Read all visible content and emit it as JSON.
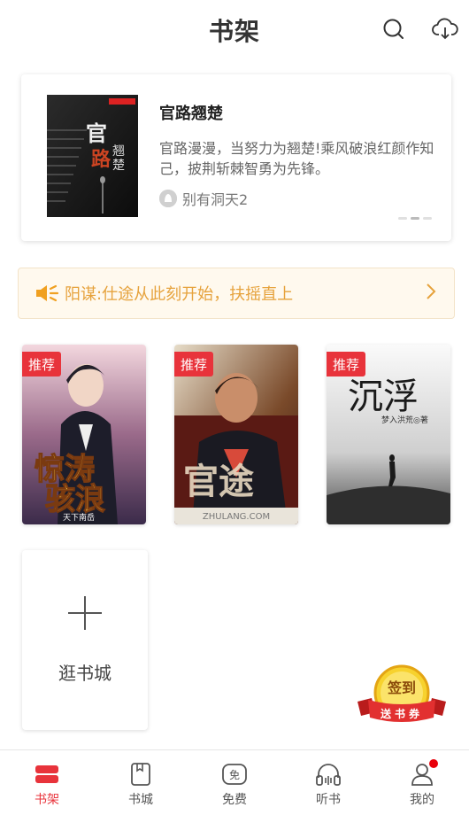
{
  "header": {
    "title": "书架",
    "search_icon": "search-icon",
    "cloud_icon": "cloud-download-icon"
  },
  "featured": {
    "cover_title": "官路翘楚",
    "title": "官路翘楚",
    "description": "官路漫漫，当努力为翘楚!乘风破浪红颜作知己，披荆斩棘智勇为先锋。",
    "author": "别有洞天2"
  },
  "notice": {
    "text": "阳谋:仕途从此刻开始，扶摇直上",
    "icon": "speaker-icon"
  },
  "books": [
    {
      "badge": "推荐",
      "cover_title": "惊涛骇浪",
      "cover_author": "天下南岳"
    },
    {
      "badge": "推荐",
      "cover_title": "官途",
      "cover_footer": "ZHULANG.COM"
    },
    {
      "badge": "推荐",
      "cover_title": "沉浮",
      "cover_author": "梦入洪荒◎著"
    }
  ],
  "add_card": {
    "label": "逛书城"
  },
  "signin": {
    "top": "签到",
    "ribbon": "送书券"
  },
  "tabs": [
    {
      "label": "书架",
      "icon": "bookshelf-icon",
      "active": true
    },
    {
      "label": "书城",
      "icon": "book-icon",
      "active": false
    },
    {
      "label": "免费",
      "icon": "free-icon",
      "icon_text": "免",
      "active": false
    },
    {
      "label": "听书",
      "icon": "headphones-icon",
      "active": false
    },
    {
      "label": "我的",
      "icon": "user-icon",
      "active": false
    }
  ],
  "colors": {
    "accent": "#e8333b",
    "notice_text": "#e6a23c",
    "notice_bg": "#fff9ee"
  }
}
